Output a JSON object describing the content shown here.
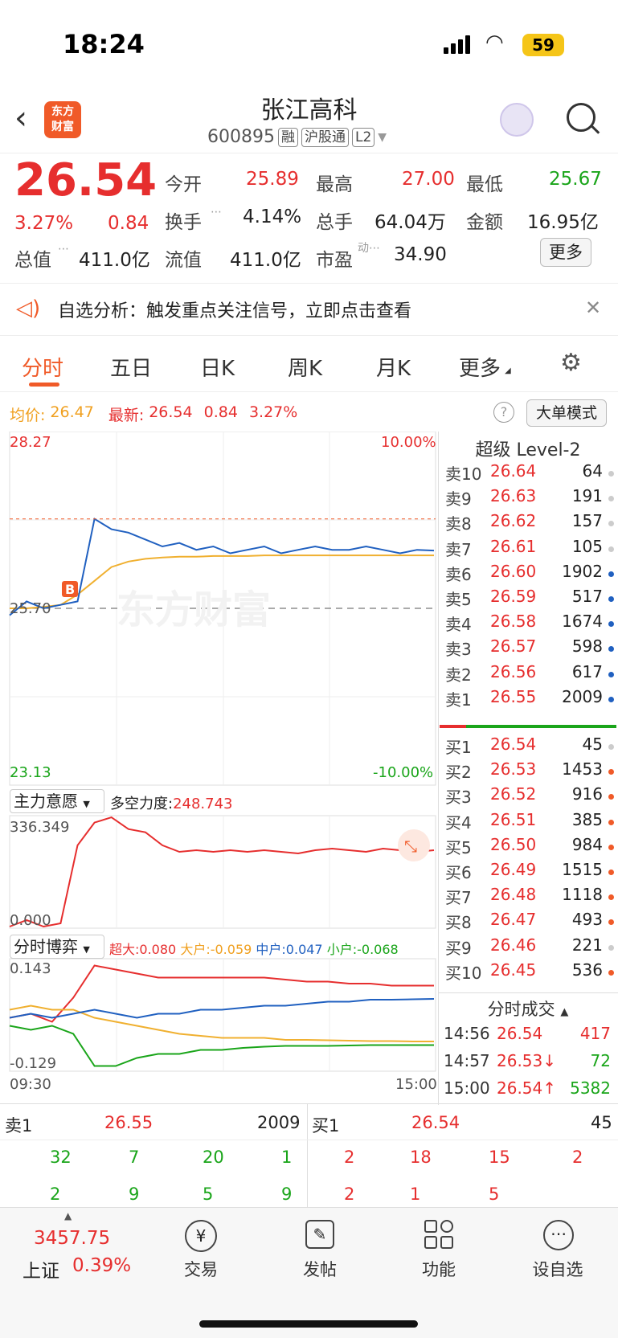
{
  "status": {
    "time": "18:24",
    "battery": "59"
  },
  "header": {
    "title": "张江高科",
    "code": "600895",
    "tags": [
      "融",
      "沪股通",
      "L2"
    ],
    "logo": "东方\n财富"
  },
  "quote": {
    "price": "26.54",
    "pct": "3.27%",
    "chg": "0.84",
    "items": [
      [
        "今开",
        "25.89"
      ],
      [
        "最高",
        "27.00"
      ],
      [
        "最低",
        "25.67"
      ],
      [
        "换手",
        "4.14%"
      ],
      [
        "总手",
        "64.04万"
      ],
      [
        "金额",
        "16.95亿"
      ],
      [
        "总值",
        "411.0亿"
      ],
      [
        "流值",
        "411.0亿"
      ],
      [
        "市盈",
        "34.90"
      ]
    ],
    "more": "更多"
  },
  "banner": {
    "text": "自选分析：触发重点关注信号，立即点击查看"
  },
  "tabs": [
    "分时",
    "五日",
    "日K",
    "周K",
    "月K",
    "更多"
  ],
  "summary": {
    "avg_label": "均价:",
    "avg": "26.47",
    "last_label": "最新:",
    "last": "26.54",
    "chg": "0.84",
    "pct": "3.27%",
    "mode": "大单模式"
  },
  "chart_data": [
    {
      "type": "line",
      "title": "",
      "y_top": "28.27",
      "y_bottom": "23.13",
      "y_ref": "25.70",
      "pct_top": "10.00%",
      "pct_bottom": "-10.00%",
      "watermark": "东方财富",
      "marker": "B",
      "series": [
        {
          "values": [
            25.6,
            25.8,
            25.7,
            25.75,
            25.8,
            27.0,
            26.85,
            26.8,
            26.7,
            26.6,
            26.65,
            26.55,
            26.6,
            26.5,
            26.55,
            26.6,
            26.5,
            26.55,
            26.6,
            26.55,
            26.55,
            26.6,
            26.55,
            26.5,
            26.55,
            26.54
          ]
        },
        {
          "values": [
            25.7,
            25.7,
            25.72,
            25.75,
            25.9,
            26.1,
            26.3,
            26.38,
            26.42,
            26.44,
            26.45,
            26.45,
            26.46,
            26.46,
            26.46,
            26.47,
            26.47,
            26.47,
            26.47,
            26.47,
            26.47,
            26.47,
            26.47,
            26.47,
            26.47,
            26.47
          ]
        }
      ]
    },
    {
      "type": "line",
      "title": "主力意愿",
      "power_label": "多空力度:",
      "power": "248.743",
      "y_top": "336.349",
      "y_bottom": "0.000",
      "series": [
        {
          "values": [
            0,
            20,
            0,
            10,
            250,
            320,
            336,
            300,
            290,
            250,
            230,
            235,
            230,
            235,
            230,
            235,
            230,
            225,
            235,
            240,
            235,
            230,
            240,
            235,
            230,
            235
          ]
        }
      ]
    },
    {
      "type": "line",
      "title": "分时博弈",
      "y_top": "0.143",
      "y_bottom": "-0.129",
      "x_start": "09:30",
      "x_end": "15:00",
      "series": [
        {
          "name": "超大",
          "value": "0.080",
          "values": [
            0,
            0.01,
            -0.01,
            0.05,
            0.13,
            0.12,
            0.11,
            0.1,
            0.1,
            0.1,
            0.1,
            0.1,
            0.1,
            0.095,
            0.09,
            0.09,
            0.085,
            0.085,
            0.08,
            0.08,
            0.08
          ]
        },
        {
          "name": "大户",
          "value": "-0.059",
          "values": [
            0.02,
            0.03,
            0.02,
            0.02,
            0,
            -0.01,
            -0.02,
            -0.03,
            -0.04,
            -0.045,
            -0.05,
            -0.05,
            -0.05,
            -0.055,
            -0.055,
            -0.056,
            -0.057,
            -0.058,
            -0.058,
            -0.059,
            -0.059
          ]
        },
        {
          "name": "中户",
          "value": "0.047",
          "values": [
            0,
            0.01,
            0,
            0.01,
            0.02,
            0.01,
            0.0,
            0.01,
            0.01,
            0.02,
            0.02,
            0.025,
            0.03,
            0.03,
            0.035,
            0.04,
            0.04,
            0.045,
            0.045,
            0.046,
            0.047
          ]
        },
        {
          "name": "小户",
          "value": "-0.068",
          "values": [
            -0.02,
            -0.03,
            -0.02,
            -0.04,
            -0.12,
            -0.12,
            -0.1,
            -0.09,
            -0.09,
            -0.08,
            -0.08,
            -0.075,
            -0.072,
            -0.07,
            -0.07,
            -0.07,
            -0.069,
            -0.068,
            -0.068,
            -0.068,
            -0.068
          ]
        }
      ]
    }
  ],
  "level2": {
    "title": "超级 Level-2",
    "asks": [
      [
        "卖10",
        "26.64",
        "64"
      ],
      [
        "卖9",
        "26.63",
        "191"
      ],
      [
        "卖8",
        "26.62",
        "157"
      ],
      [
        "卖7",
        "26.61",
        "105"
      ],
      [
        "卖6",
        "26.60",
        "1902"
      ],
      [
        "卖5",
        "26.59",
        "517"
      ],
      [
        "卖4",
        "26.58",
        "1674"
      ],
      [
        "卖3",
        "26.57",
        "598"
      ],
      [
        "卖2",
        "26.56",
        "617"
      ],
      [
        "卖1",
        "26.55",
        "2009"
      ]
    ],
    "bids": [
      [
        "买1",
        "26.54",
        "45"
      ],
      [
        "买2",
        "26.53",
        "1453"
      ],
      [
        "买3",
        "26.52",
        "916"
      ],
      [
        "买4",
        "26.51",
        "385"
      ],
      [
        "买5",
        "26.50",
        "984"
      ],
      [
        "买6",
        "26.49",
        "1515"
      ],
      [
        "买7",
        "26.48",
        "1118"
      ],
      [
        "买8",
        "26.47",
        "493"
      ],
      [
        "买9",
        "26.46",
        "221"
      ],
      [
        "买10",
        "26.45",
        "536"
      ]
    ],
    "trades_title": "分时成交",
    "trades": [
      [
        "14:56",
        "26.54",
        "417"
      ],
      [
        "14:57",
        "26.53↓",
        "72"
      ],
      [
        "15:00",
        "26.54↑",
        "5382"
      ]
    ]
  },
  "queue": {
    "ask_label": "卖1",
    "ask_price": "26.55",
    "ask_vol": "2009",
    "bid_label": "买1",
    "bid_price": "26.54",
    "bid_vol": "45",
    "ask_row1": [
      "32",
      "7",
      "20",
      "1"
    ],
    "ask_row2": [
      "2",
      "9",
      "5",
      "9"
    ],
    "bid_row1": [
      "2",
      "18",
      "15",
      "2"
    ],
    "bid_row2": [
      "2",
      "1",
      "5"
    ]
  },
  "bottom": {
    "index_value": "3457.75",
    "index_name": "上证",
    "index_pct": "0.39%",
    "nav": [
      "交易",
      "发帖",
      "功能",
      "设自选"
    ]
  }
}
